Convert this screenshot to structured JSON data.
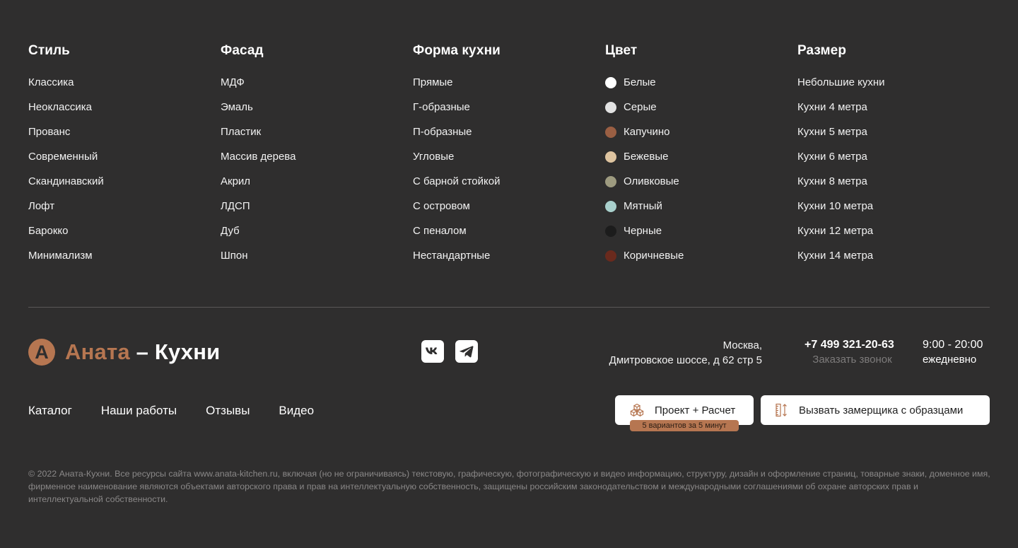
{
  "columns": [
    {
      "title": "Стиль",
      "items": [
        {
          "label": "Классика"
        },
        {
          "label": "Неоклассика"
        },
        {
          "label": "Прованс"
        },
        {
          "label": "Современный"
        },
        {
          "label": "Скандинавский"
        },
        {
          "label": "Лофт"
        },
        {
          "label": "Барокко"
        },
        {
          "label": "Минимализм"
        }
      ]
    },
    {
      "title": "Фасад",
      "items": [
        {
          "label": "МДФ"
        },
        {
          "label": "Эмаль"
        },
        {
          "label": "Пластик"
        },
        {
          "label": "Массив дерева"
        },
        {
          "label": "Акрил"
        },
        {
          "label": "ЛДСП"
        },
        {
          "label": "Дуб"
        },
        {
          "label": "Шпон"
        }
      ]
    },
    {
      "title": "Форма кухни",
      "items": [
        {
          "label": "Прямые"
        },
        {
          "label": "Г-образные"
        },
        {
          "label": "П-образные"
        },
        {
          "label": "Угловые"
        },
        {
          "label": "С барной стойкой"
        },
        {
          "label": "С островом"
        },
        {
          "label": "С пеналом"
        },
        {
          "label": "Нестандартные"
        }
      ]
    },
    {
      "title": "Цвет",
      "items": [
        {
          "label": "Белые",
          "color": "#ffffff"
        },
        {
          "label": "Серые",
          "color": "#e2e2e2"
        },
        {
          "label": "Капучино",
          "color": "#9a5f43"
        },
        {
          "label": "Бежевые",
          "color": "#dec4a0"
        },
        {
          "label": "Оливковые",
          "color": "#9e9b80"
        },
        {
          "label": "Мятный",
          "color": "#a9d0cc"
        },
        {
          "label": "Черные",
          "color": "#1c1c1c"
        },
        {
          "label": "Коричневые",
          "color": "#6a2a1d"
        }
      ]
    },
    {
      "title": "Размер",
      "items": [
        {
          "label": "Небольшие кухни"
        },
        {
          "label": "Кухни 4 метра"
        },
        {
          "label": "Кухни 5 метра"
        },
        {
          "label": "Кухни 6 метра"
        },
        {
          "label": "Кухни 8 метра"
        },
        {
          "label": "Кухни 10 метра"
        },
        {
          "label": "Кухни 12 метра"
        },
        {
          "label": "Кухни 14 метра"
        }
      ]
    }
  ],
  "brand": {
    "mark": "А",
    "accent": "Аната",
    "rest": " – Кухни",
    "accent_color": "#b67651"
  },
  "socials": [
    {
      "name": "vk-icon"
    },
    {
      "name": "telegram-icon"
    }
  ],
  "contact": {
    "address_line1": "Москва,",
    "address_line2": "Дмитровское шоссе, д 62 стр 5",
    "phone": "+7 499 321-20-63",
    "callback": "Заказать звонок",
    "hours": "9:00 - 20:00",
    "days": "ежедневно"
  },
  "nav": [
    "Каталог",
    "Наши работы",
    "Отзывы",
    "Видео"
  ],
  "buttons": {
    "project": "Проект + Расчет",
    "project_badge": "5 вариантов за 5 минут",
    "measure": "Вызвать замерщика с образцами"
  },
  "copyright": "© 2022 Аната-Кухни. Все ресурсы сайта www.anata-kitchen.ru, включая (но не ограничиваясь) текстовую, графическую, фотографическую и видео информацию, структуру, дизайн и оформление страниц, товарные знаки, доменное имя, фирменное наименование являются объектами авторского права и прав на интеллектуальную собственность, защищены российским законодательством и международными соглашениями об охране авторских прав и интеллектуальной собственности.",
  "colors": {
    "background": "#2f2e2e",
    "accent": "#b67651",
    "muted_text": "#8a8888"
  }
}
